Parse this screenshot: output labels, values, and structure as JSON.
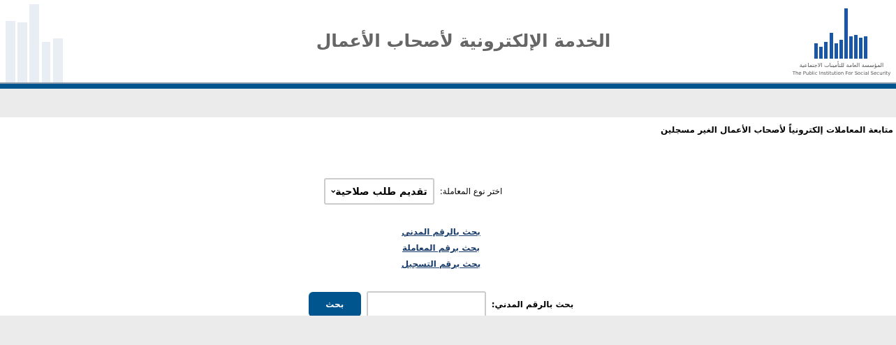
{
  "header": {
    "title": "الخدمة الإلكترونية لأصحاب الأعمال",
    "logo_arabic": "المؤسسة العامة للتأمينات الاجتماعية",
    "logo_english": "The Public Institution For Social Security"
  },
  "page_heading": "متابعة المعاملات إلكترونياً لأصحاب الأعمال الغير مسجلين",
  "transaction_type": {
    "label": "اختر نوع المعاملة:",
    "value": "تقديم طلب صلاحية"
  },
  "search_links": [
    "بحث بالرقم المدني",
    "بحث برقم المعاملة",
    "بحث برقم التسجيل"
  ],
  "search": {
    "label": "بحث بالرقم المدني:",
    "button": "بحث"
  }
}
